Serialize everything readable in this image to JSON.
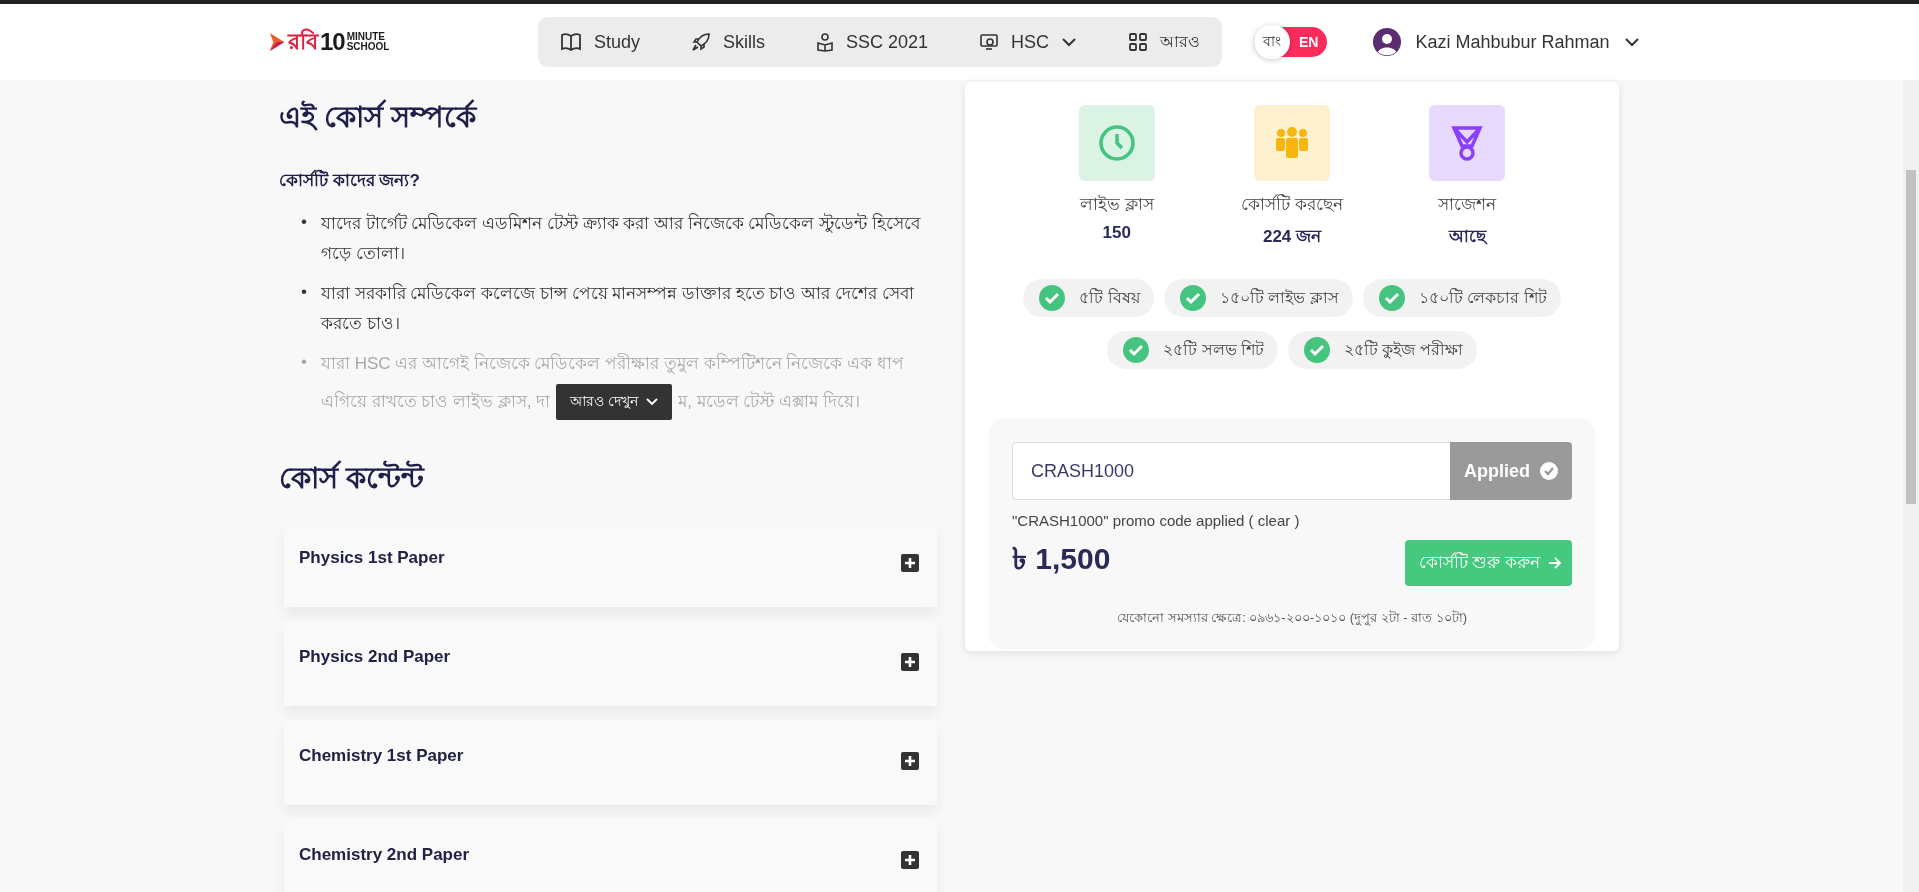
{
  "header": {
    "logo_bangla": "রবি",
    "logo_number": "10",
    "logo_word_1": "MINUTE",
    "logo_word_2": "SCHOOL",
    "nav": [
      {
        "kind": "book",
        "label": "Study",
        "dropdown": false
      },
      {
        "kind": "rocket",
        "label": "Skills",
        "dropdown": false
      },
      {
        "kind": "reader",
        "label": "SSC 2021",
        "dropdown": false
      },
      {
        "kind": "screen",
        "label": "HSC",
        "dropdown": true
      },
      {
        "kind": "grid",
        "label": "আরও",
        "dropdown": false
      }
    ],
    "languages": [
      {
        "label": "বাং",
        "selected": false
      },
      {
        "label": "EN",
        "selected": true
      }
    ],
    "user": {
      "name": "Kazi Mahbubur Rahman"
    }
  },
  "about": {
    "title": "এই কোর্স সম্পর্কে",
    "subtitle": "কোর্সটি কাদের জন্য?",
    "bullets": [
      {
        "marker": "•",
        "text": "যাদের টার্গেট মেডিকেল এডমিশন টেস্ট ক্র্যাক করা আর নিজেকে মেডিকেল স্টুডেন্ট হিসেবে গড়ে তোলা।",
        "faded": false
      },
      {
        "marker": "•",
        "text": "যারা সরকারি মেডিকেল কলেজে চান্স পেয়ে মানসম্পন্ন ডাক্তার হতে চাও আর দেশের সেবা করতে চাও।",
        "faded": false
      }
    ],
    "faded_bullet": {
      "marker": "•",
      "line_1": "যারা HSC এর আগেই নিজেকে মেডিকেল পরীক্ষার তুমুল কম্পিটিশনে নিজেকে এক ধাপ",
      "line_2_start": "এগিয়ে রাখতে চাও লাইভ ক্লাস, দা",
      "line_2_end": "ম, মডেল টেস্ট এক্সাম দিয়ে।"
    },
    "more_button": "আরও দেখুন"
  },
  "content": {
    "title": "কোর্স কন্টেন্ট",
    "items": [
      {
        "title": "Physics 1st Paper",
        "expanded": false
      },
      {
        "title": "Physics 2nd Paper",
        "expanded": false
      },
      {
        "title": "Chemistry 1st Paper",
        "expanded": false
      },
      {
        "title": "Chemistry 2nd Paper",
        "expanded": false
      }
    ]
  },
  "card": {
    "stats": [
      {
        "kind": "clock",
        "color": "#45c47f",
        "label": "লাইভ ক্লাস",
        "value": "150"
      },
      {
        "kind": "people",
        "color": "#f5b70f",
        "label": "কোর্সটি করছেন",
        "value": "224 জন"
      },
      {
        "kind": "medal",
        "color": "#8a3ffc",
        "label": "সাজেশন",
        "value": "আছে"
      }
    ],
    "features": [
      "৫টি বিষয়",
      "১৫০টি লাইভ ক্লাস",
      "১৫০টি লেকচার শিট",
      "২৫টি সলভ শিট",
      "২৫টি কুইজ পরীক্ষা"
    ],
    "promo": {
      "value": "CRASH1000",
      "button": "Applied",
      "applied": true,
      "note": "\"CRASH1000\" promo code applied (",
      "clear_link": "clear",
      "note_end": ")"
    },
    "price": "৳ 1,500",
    "cta": "কোর্সটি শুরু করুন",
    "help": "যেকোনো সমস্যার ক্ষেত্রে: ০৯৬১-২০০-১০১০ (দুপুর ২টা - রাত ১০টা)"
  }
}
